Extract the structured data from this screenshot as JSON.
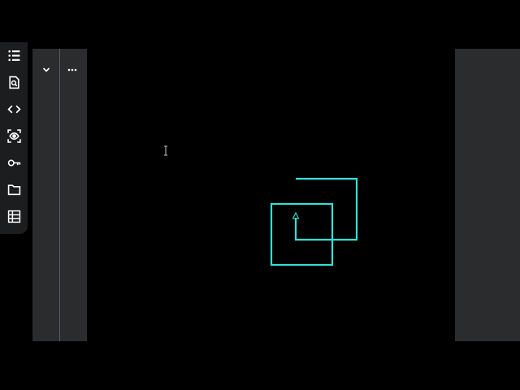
{
  "rail": {
    "icons": [
      {
        "name": "list-icon"
      },
      {
        "name": "search-document-icon"
      },
      {
        "name": "code-icon"
      },
      {
        "name": "preview-eye-icon"
      },
      {
        "name": "key-icon"
      },
      {
        "name": "folder-icon"
      },
      {
        "name": "table-icon"
      }
    ]
  },
  "panel": {
    "collapse_icon": "chevron-down-icon",
    "more_icon": "more-horizontal-icon"
  },
  "canvas": {
    "stroke_color": "#33e0d6",
    "cursor_icon": "text-cursor-icon"
  },
  "colors": {
    "background": "#000000",
    "panel": "#2a2c2e",
    "rail": "#1c1d1f",
    "icon": "#ffffff",
    "accent": "#33e0d6"
  }
}
